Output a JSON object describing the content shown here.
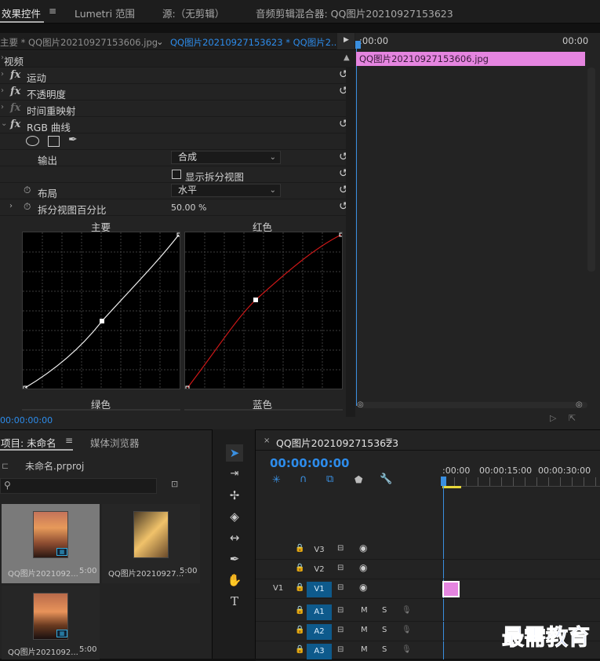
{
  "top_tabs": {
    "effect_controls": "效果控件",
    "lumetri": "Lumetri 范围",
    "source": "源:（无剪辑）",
    "audio_mixer": "音频剪辑混合器: QQ图片20210927153623"
  },
  "ec_header": {
    "master": "主要 * QQ图片20210927153606.jpg",
    "sequence": "QQ图片20210927153623 * QQ图片2...",
    "play_icon": "play-icon"
  },
  "ec_timeline": {
    "start": ":00:00",
    "end": "00:00",
    "clip_name": "QQ图片20210927153606.jpg"
  },
  "effects": {
    "section": "视频",
    "motion": "运动",
    "opacity": "不透明度",
    "time_remap": "时间重映射",
    "rgb_curves": "RGB 曲线",
    "output_label": "输出",
    "output_value": "合成",
    "show_split": "显示拆分视图",
    "layout_label": "布局",
    "layout_value": "水平",
    "split_pct_label": "拆分视图百分比",
    "split_pct_value": "50.00 %"
  },
  "curves": {
    "master": "主要",
    "red": "红色",
    "green": "绿色",
    "blue": "蓝色"
  },
  "ec_timecode": "00:00:00:00",
  "project": {
    "tab": "项目: 未命名",
    "media_browser": "媒体浏览器",
    "file": "未命名.prproj",
    "items": [
      {
        "name": "QQ图片2021092...",
        "dur": "5:00"
      },
      {
        "name": "QQ图片20210927...",
        "dur": "5:00"
      },
      {
        "name": "QQ图片2021092...",
        "dur": "5:00"
      }
    ]
  },
  "sequence": {
    "tab": "QQ图片20210927153623",
    "timecode": "00:00:00:00",
    "ruler": [
      ":00:00",
      "00:00:15:00",
      "00:00:30:00"
    ],
    "video_tracks": [
      "V3",
      "V2",
      "V1"
    ],
    "source_patch": "V1",
    "audio_tracks": [
      "A1",
      "A2",
      "A3"
    ],
    "mute": "M",
    "solo": "S"
  },
  "watermark": "最需教育",
  "colors": {
    "accent": "#2d8ceb",
    "clip": "#e585e0",
    "track_target": "#0e5a8c"
  }
}
